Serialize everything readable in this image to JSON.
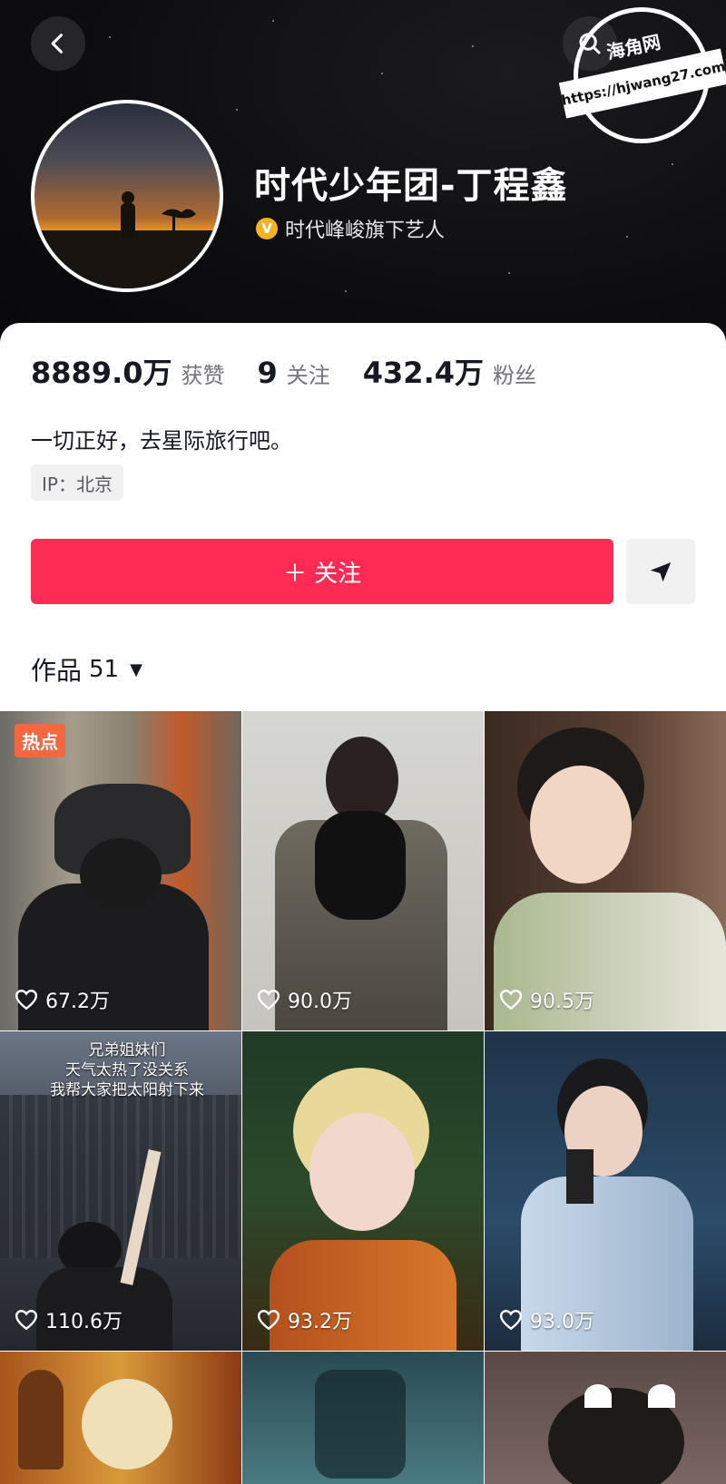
{
  "header": {
    "username": "时代少年团-丁程鑫",
    "verified_badge": "V",
    "verified_text": "时代峰峻旗下艺人"
  },
  "watermark": {
    "title": "海角网",
    "url": "https://hjwang27.com"
  },
  "stats": {
    "likes_count": "8889.0万",
    "likes_label": "获赞",
    "following_count": "9",
    "following_label": "关注",
    "followers_count": "432.4万",
    "followers_label": "粉丝"
  },
  "bio": "一切正好，去星际旅行吧。",
  "ip_location": "IP：北京",
  "actions": {
    "follow_label": "＋ 关注"
  },
  "works": {
    "label": "作品",
    "count": "51"
  },
  "videos": [
    {
      "likes": "67.2万",
      "badge": "热点"
    },
    {
      "likes": "90.0万"
    },
    {
      "likes": "90.5万"
    },
    {
      "likes": "110.6万",
      "caption": "兄弟姐妹们\n天气太热了没关系\n我帮大家把太阳射下来"
    },
    {
      "likes": "93.2万"
    },
    {
      "likes": "93.0万"
    },
    {},
    {},
    {}
  ],
  "colors": {
    "accent": "#fe2c55",
    "hot_badge": "#f4673f",
    "verified": "#f5b223"
  }
}
